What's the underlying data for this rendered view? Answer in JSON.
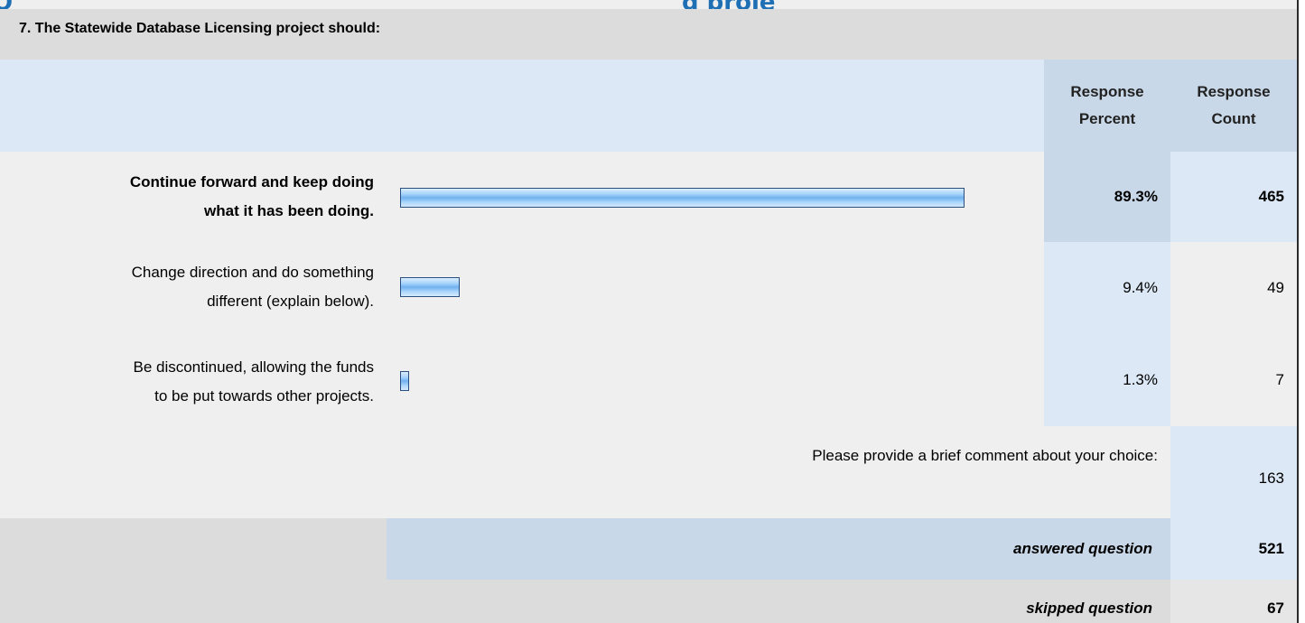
{
  "question": {
    "title": "7. The Statewide Database Licensing project should:"
  },
  "headers": {
    "percent": [
      "Response",
      "Percent"
    ],
    "count": [
      "Response",
      "Count"
    ]
  },
  "chart_data": {
    "type": "bar",
    "orientation": "horizontal",
    "title": "7. The Statewide Database Licensing project should:",
    "categories": [
      [
        "Continue forward and keep doing",
        "what it has been doing."
      ],
      [
        "Change direction and do something",
        "different (explain below)."
      ],
      [
        "Be discontinued, allowing the funds",
        "to be put towards other projects."
      ]
    ],
    "series": [
      {
        "name": "Response Percent",
        "values": [
          "89.3%",
          "9.4%",
          "1.3%"
        ],
        "numeric": [
          89.3,
          9.4,
          1.3
        ]
      },
      {
        "name": "Response Count",
        "values": [
          "465",
          "49",
          "7"
        ]
      }
    ],
    "xlim": [
      0,
      100
    ],
    "grid": false,
    "legend": "none"
  },
  "comment": {
    "prompt": "Please provide a brief comment about your choice:",
    "count": "163"
  },
  "summary": {
    "answered_label": "answered question",
    "answered_value": "521",
    "skipped_label": "skipped question",
    "skipped_value": "67"
  },
  "fragment": {
    "left": "Q",
    "right": "g proje"
  },
  "colors": {
    "bar_fill": "#6fb1ef",
    "bar_border": "#2a4f80",
    "header_blue": "#c9d8e8",
    "light_blue": "#dce8f6",
    "grey": "#dcdcdc",
    "heading_blue": "#1f6fb5"
  }
}
